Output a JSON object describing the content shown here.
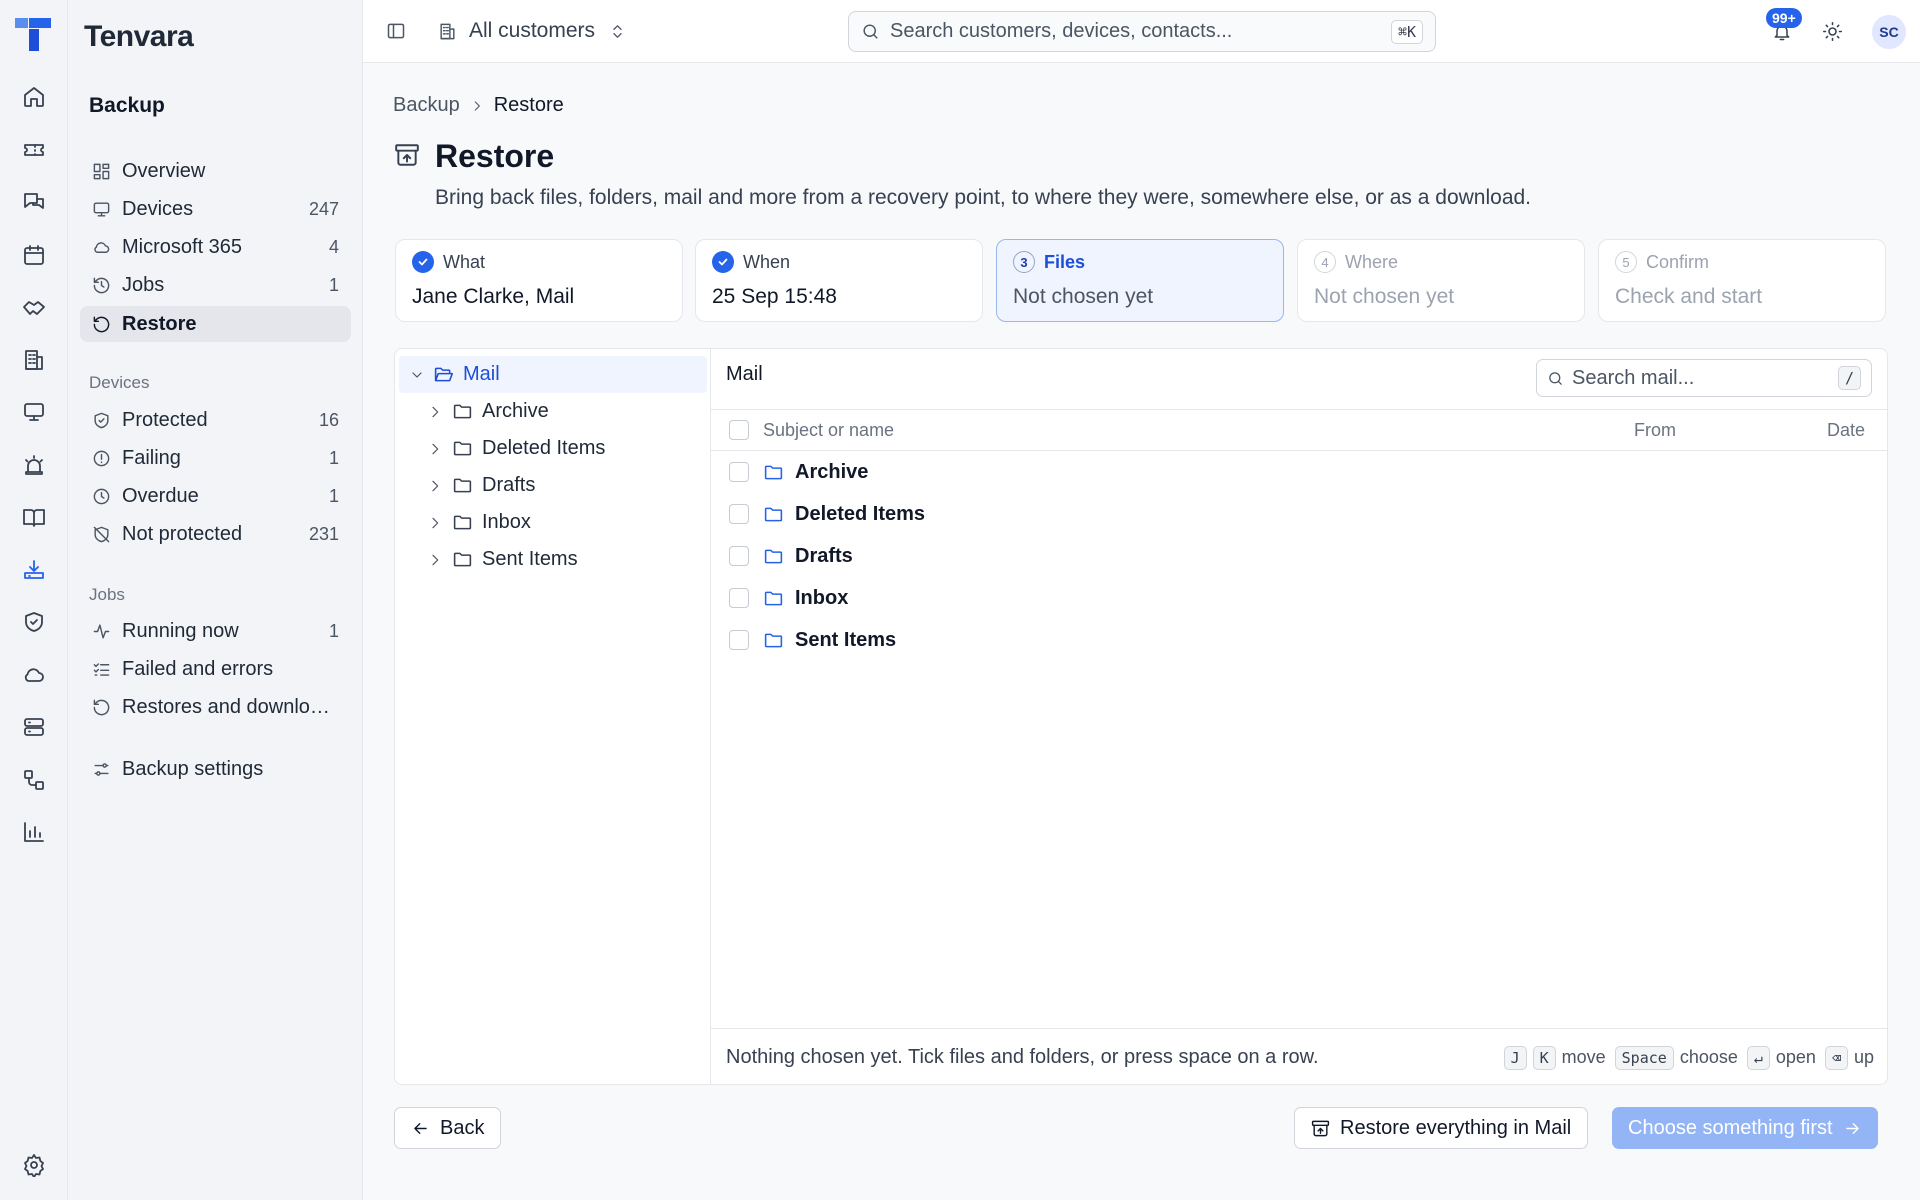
{
  "app": {
    "name": "Tenvara"
  },
  "sidebar": {
    "section_title": "Backup",
    "items": [
      {
        "label": "Overview",
        "count": "",
        "icon": "layout-grid-icon"
      },
      {
        "label": "Devices",
        "count": "247",
        "icon": "monitor-icon"
      },
      {
        "label": "Microsoft 365",
        "count": "4",
        "icon": "cloud-icon"
      },
      {
        "label": "Jobs",
        "count": "1",
        "icon": "history-icon"
      },
      {
        "label": "Restore",
        "count": "",
        "icon": "rotate-ccw-icon",
        "active": true
      }
    ],
    "devices_group": {
      "title": "Devices",
      "items": [
        {
          "label": "Protected",
          "count": "16",
          "icon": "shield-check-icon"
        },
        {
          "label": "Failing",
          "count": "1",
          "icon": "alert-circle-icon"
        },
        {
          "label": "Overdue",
          "count": "1",
          "icon": "clock-icon"
        },
        {
          "label": "Not protected",
          "count": "231",
          "icon": "shield-off-icon"
        }
      ]
    },
    "jobs_group": {
      "title": "Jobs",
      "items": [
        {
          "label": "Running now",
          "count": "1",
          "icon": "activity-icon"
        },
        {
          "label": "Failed and errors",
          "count": "",
          "icon": "list-checks-icon"
        },
        {
          "label": "Restores and downloads",
          "count": "",
          "icon": "rotate-ccw-icon"
        }
      ]
    },
    "settings": {
      "label": "Backup settings",
      "icon": "settings-sliders-icon"
    }
  },
  "topbar": {
    "customer_selector": "All customers",
    "search_placeholder": "Search customers, devices, contacts...",
    "search_shortcut": "⌘K",
    "notification_badge": "99+",
    "avatar_initials": "SC"
  },
  "breadcrumb": {
    "parent": "Backup",
    "current": "Restore"
  },
  "page": {
    "title": "Restore",
    "description": "Bring back files, folders, mail and more from a recovery point, to where they were, somewhere else, or as a download."
  },
  "steps": [
    {
      "number": "",
      "title": "What",
      "value": "Jane Clarke, Mail",
      "state": "done"
    },
    {
      "number": "",
      "title": "When",
      "value": "25 Sep 15:48",
      "state": "done"
    },
    {
      "number": "3",
      "title": "Files",
      "value": "Not chosen yet",
      "state": "current"
    },
    {
      "number": "4",
      "title": "Where",
      "value": "Not chosen yet",
      "state": "disabled"
    },
    {
      "number": "5",
      "title": "Confirm",
      "value": "Check and start",
      "state": "disabled"
    }
  ],
  "tree": {
    "root": "Mail",
    "children": [
      "Archive",
      "Deleted Items",
      "Drafts",
      "Inbox",
      "Sent Items"
    ]
  },
  "files": {
    "title": "Mail",
    "search_placeholder": "Search mail...",
    "search_shortcut": "/",
    "columns": {
      "name": "Subject or name",
      "from": "From",
      "date": "Date"
    },
    "rows": [
      "Archive",
      "Deleted Items",
      "Drafts",
      "Inbox",
      "Sent Items"
    ],
    "status": "Nothing chosen yet. Tick files and folders, or press space on a row.",
    "hints": {
      "key_j": "J",
      "key_k": "K",
      "move": "move",
      "key_space": "Space",
      "choose": "choose",
      "key_enter": "↵",
      "open": "open",
      "key_back": "⌫",
      "up": "up"
    }
  },
  "actions": {
    "back": "Back",
    "restore_all": "Restore everything in Mail",
    "primary": "Choose something first"
  },
  "colors": {
    "accent": "#2563eb",
    "primary_disabled": "#93b4f5",
    "selected_bg": "#eff4fe"
  }
}
